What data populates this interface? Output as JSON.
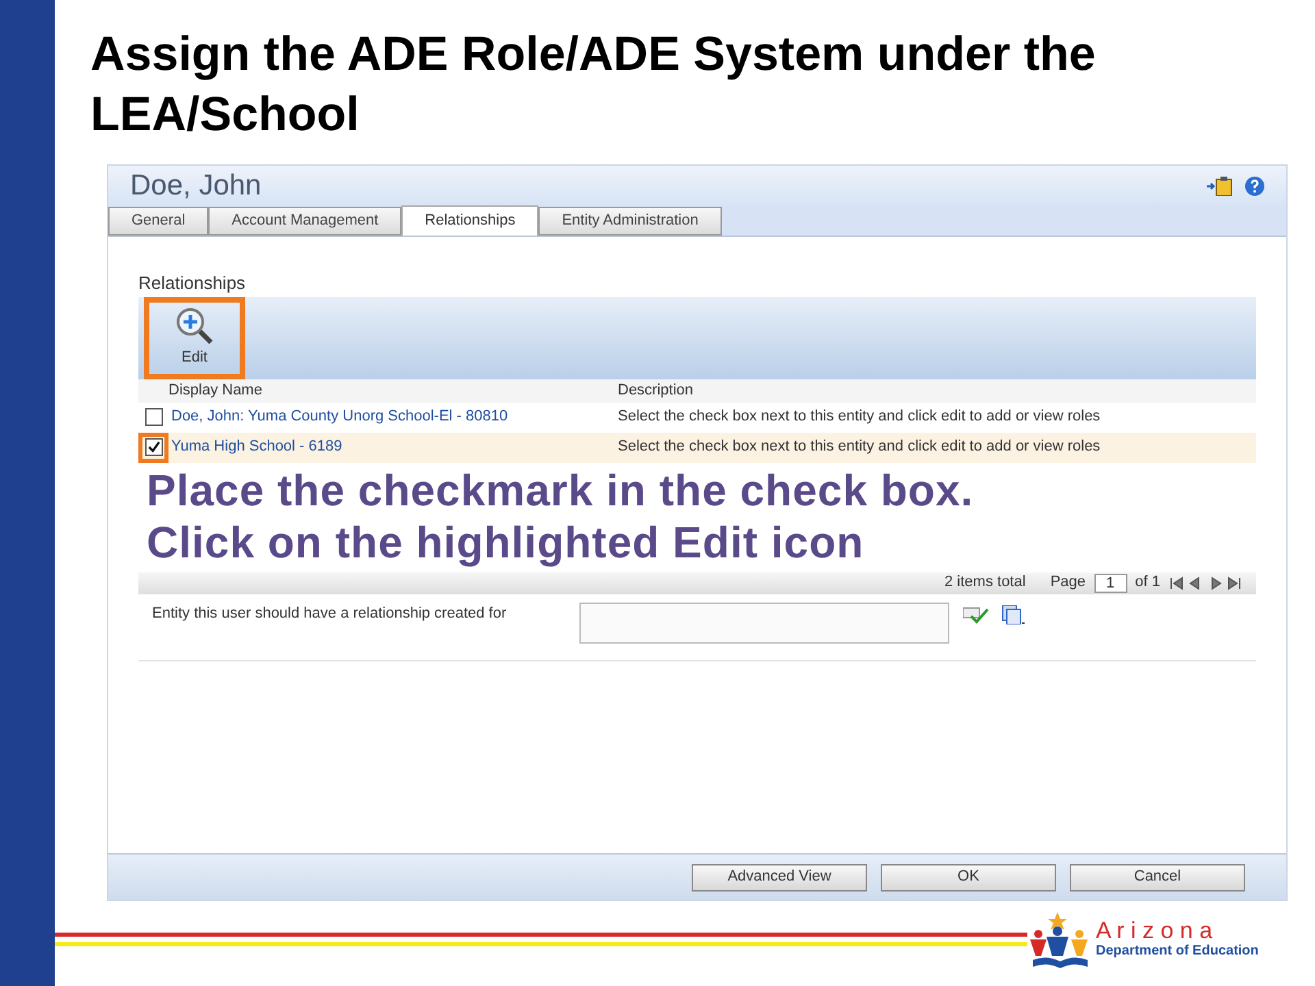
{
  "slide_title": "Assign the ADE Role/ADE System under the LEA/School",
  "window": {
    "title": "Doe, John"
  },
  "tabs": [
    {
      "label": "General",
      "selected": false
    },
    {
      "label": "Account Management",
      "selected": false
    },
    {
      "label": "Relationships",
      "selected": true
    },
    {
      "label": "Entity Administration",
      "selected": false
    }
  ],
  "section_title": "Relationships",
  "toolbar": [
    {
      "label": "Edit",
      "highlighted": true
    }
  ],
  "table": {
    "columns": [
      "Display Name",
      "Description"
    ],
    "rows": [
      {
        "checked": false,
        "highlighted": false,
        "selected": false,
        "cells": [
          "Doe, John: Yuma County Unorg School-El - 80810",
          "Select the check box next to this entity and click edit to add or view roles"
        ]
      },
      {
        "checked": true,
        "highlighted": true,
        "selected": true,
        "cells": [
          "Yuma High School - 6189",
          "Select the check box next to this entity and click edit to add or view roles"
        ]
      }
    ]
  },
  "callout": [
    "Place the checkmark in the check box.",
    "Click on the highlighted Edit icon"
  ],
  "pager": {
    "total": "2 items total",
    "page_label": "Page",
    "page": "1",
    "of": "of 1"
  },
  "entity_field": {
    "label": "Entity this user should have a relationship created for"
  },
  "buttons": [
    "Advanced View",
    "OK",
    "Cancel"
  ],
  "logo": {
    "name": "A r i z o n a",
    "subtitle": "Department of Education"
  }
}
